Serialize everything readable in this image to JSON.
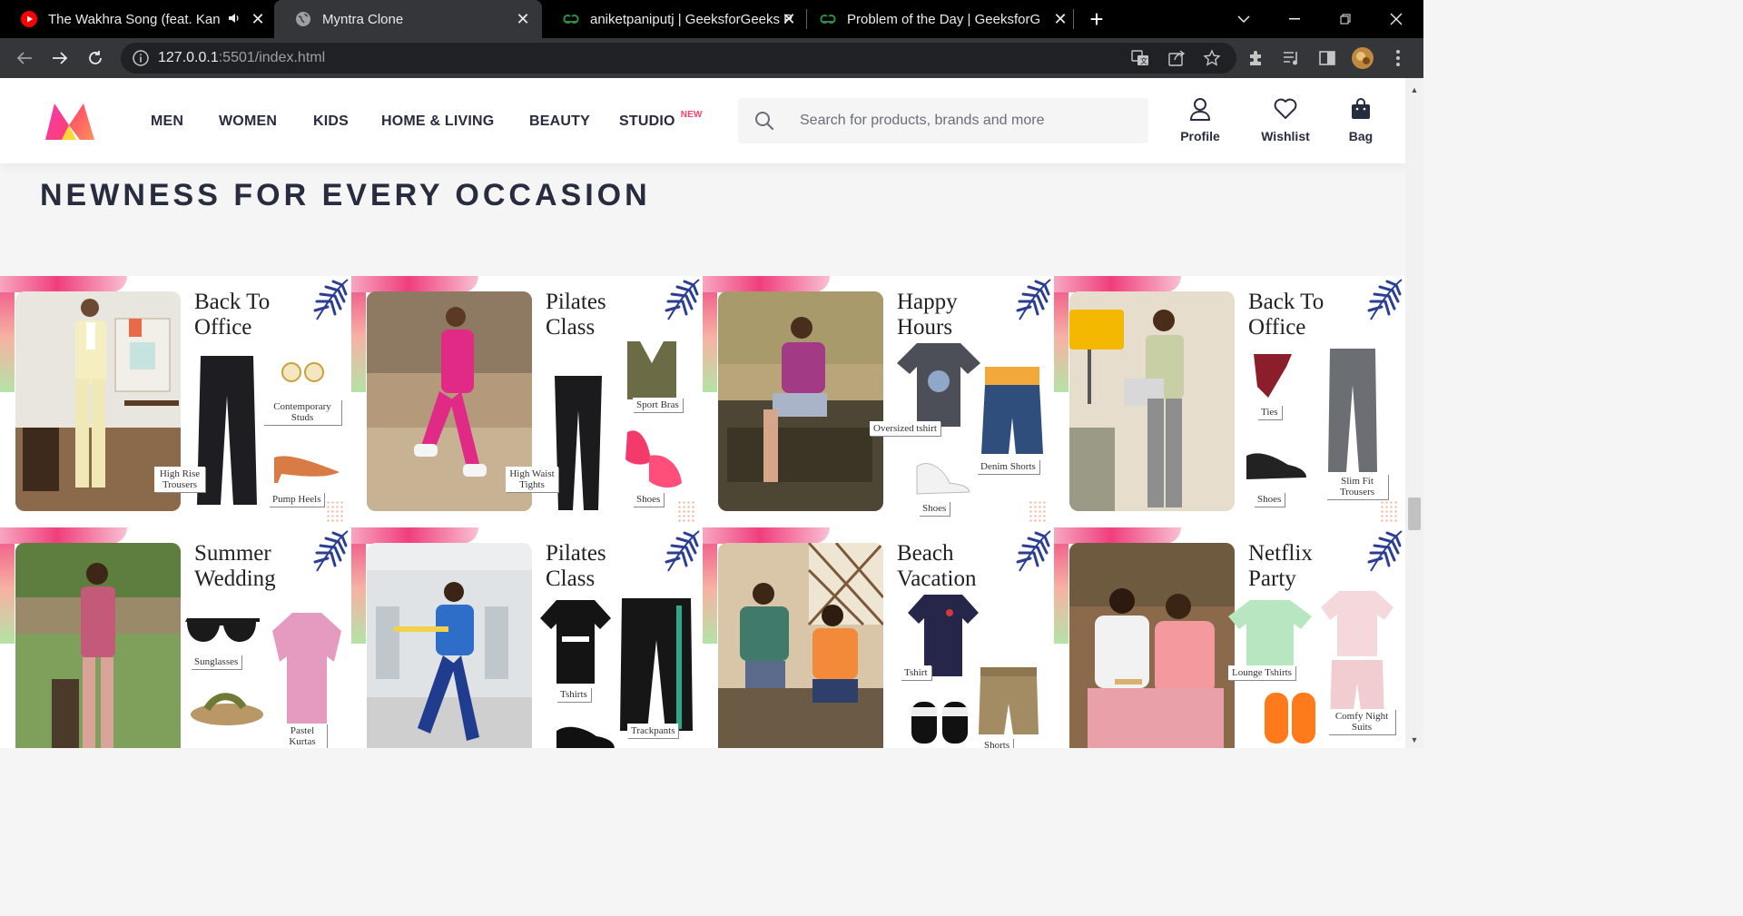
{
  "browser": {
    "tabs": [
      {
        "title": "The Wakhra Song (feat. Kang",
        "favicon": "youtube-icon",
        "audio": true,
        "active": false
      },
      {
        "title": "Myntra Clone",
        "favicon": "globe-icon",
        "audio": false,
        "active": true
      },
      {
        "title": "aniketpaniputj | GeeksforGeeks P",
        "favicon": "gfg-icon",
        "audio": false,
        "active": false
      },
      {
        "title": "Problem of the Day | GeeksforGe",
        "favicon": "gfg-icon",
        "audio": false,
        "active": false
      }
    ],
    "url_host": "127.0.0.1",
    "url_rest": ":5501/index.html"
  },
  "header": {
    "nav": [
      "MEN",
      "WOMEN",
      "KIDS",
      "HOME & LIVING",
      "BEAUTY",
      "STUDIO"
    ],
    "studio_badge": "NEW",
    "search_placeholder": "Search for products, brands and more",
    "actions": [
      "Profile",
      "Wishlist",
      "Bag"
    ]
  },
  "section": {
    "title": "NEWNESS FOR EVERY OCCASION"
  },
  "cards": [
    {
      "occasion": [
        "Back To",
        "Office"
      ],
      "tags": [
        "Contemporary Studs",
        "High Rise Trousers",
        "Pump Heels"
      ]
    },
    {
      "occasion": [
        "Pilates",
        "Class"
      ],
      "tags": [
        "Sport Bras",
        "High Waist Tights",
        "Shoes"
      ]
    },
    {
      "occasion": [
        "Happy",
        "Hours"
      ],
      "tags": [
        "Oversized tshirt",
        "Denim Shorts",
        "Shoes"
      ]
    },
    {
      "occasion": [
        "Back To",
        "Office"
      ],
      "tags": [
        "Ties",
        "Shoes",
        "Slim Fit Trousers"
      ]
    },
    {
      "occasion": [
        "Summer",
        "Wedding"
      ],
      "tags": [
        "Sunglasses",
        "Pastel Kurtas"
      ]
    },
    {
      "occasion": [
        "Pilates",
        "Class"
      ],
      "tags": [
        "Tshirts",
        "Trackpants"
      ]
    },
    {
      "occasion": [
        "Beach",
        "Vacation"
      ],
      "tags": [
        "Tshirt",
        "Shorts"
      ]
    },
    {
      "occasion": [
        "Netflix",
        "Party"
      ],
      "tags": [
        "Lounge Tshirts",
        "Comfy Night Suits"
      ]
    }
  ],
  "colors": {
    "brand_pink": "#ff3f6c",
    "text_dark": "#282c3f",
    "leaf_blue": "#2c3e94"
  }
}
